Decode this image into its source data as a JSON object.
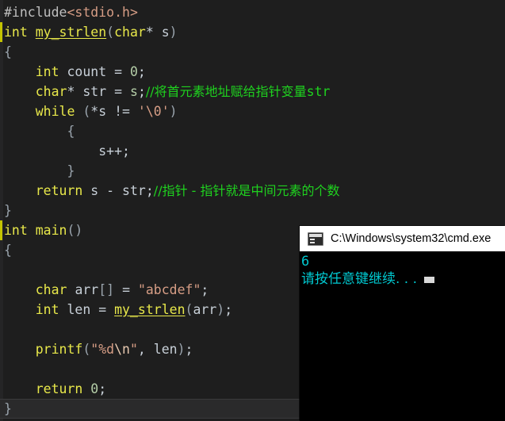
{
  "editor": {
    "theme_background": "#1e1e1e",
    "lines": [
      {
        "indent": 0,
        "tokens": [
          {
            "t": "#include",
            "c": "pp"
          },
          {
            "t": "<stdio.h>",
            "c": "hdr"
          }
        ]
      },
      {
        "indent": 0,
        "changed": true,
        "tokens": [
          {
            "t": "int",
            "c": "kw"
          },
          {
            "t": " ",
            "c": "punc"
          },
          {
            "t": "my_strlen",
            "c": "fn"
          },
          {
            "t": "(",
            "c": "brc"
          },
          {
            "t": "char",
            "c": "kw"
          },
          {
            "t": "* ",
            "c": "punc"
          },
          {
            "t": "s",
            "c": "id"
          },
          {
            "t": ")",
            "c": "brc"
          }
        ]
      },
      {
        "indent": 0,
        "tokens": [
          {
            "t": "{",
            "c": "brc"
          }
        ]
      },
      {
        "indent": 1,
        "tokens": [
          {
            "t": "int",
            "c": "kw"
          },
          {
            "t": " ",
            "c": "punc"
          },
          {
            "t": "count",
            "c": "id"
          },
          {
            "t": " = ",
            "c": "punc"
          },
          {
            "t": "0",
            "c": "num"
          },
          {
            "t": ";",
            "c": "punc"
          }
        ]
      },
      {
        "indent": 1,
        "tokens": [
          {
            "t": "char",
            "c": "kw"
          },
          {
            "t": "* ",
            "c": "punc"
          },
          {
            "t": "str",
            "c": "id"
          },
          {
            "t": " = ",
            "c": "punc"
          },
          {
            "t": "s",
            "c": "num"
          },
          {
            "t": ";",
            "c": "punc"
          },
          {
            "t": "//将首元素地址赋给指针变量",
            "c": "cmt cjk"
          },
          {
            "t": "str",
            "c": "cmt"
          }
        ]
      },
      {
        "indent": 1,
        "tokens": [
          {
            "t": "while",
            "c": "kw"
          },
          {
            "t": " ",
            "c": "punc"
          },
          {
            "t": "(",
            "c": "brc"
          },
          {
            "t": "*s != ",
            "c": "punc"
          },
          {
            "t": "'\\0'",
            "c": "str"
          },
          {
            "t": ")",
            "c": "brc"
          }
        ]
      },
      {
        "indent": 2,
        "tokens": [
          {
            "t": "{",
            "c": "brc"
          }
        ]
      },
      {
        "indent": 3,
        "tokens": [
          {
            "t": "s++;",
            "c": "id"
          }
        ]
      },
      {
        "indent": 2,
        "tokens": [
          {
            "t": "}",
            "c": "brc"
          }
        ]
      },
      {
        "indent": 1,
        "tokens": [
          {
            "t": "return",
            "c": "kw"
          },
          {
            "t": " ",
            "c": "punc"
          },
          {
            "t": "s",
            "c": "id"
          },
          {
            "t": " - ",
            "c": "punc"
          },
          {
            "t": "str",
            "c": "id"
          },
          {
            "t": ";",
            "c": "punc"
          },
          {
            "t": "//指针 - 指针就是中间元素的个数",
            "c": "cmt cjk"
          }
        ]
      },
      {
        "indent": 0,
        "tokens": [
          {
            "t": "}",
            "c": "brc"
          }
        ]
      },
      {
        "indent": 0,
        "changed": true,
        "tokens": [
          {
            "t": "int",
            "c": "kw"
          },
          {
            "t": " ",
            "c": "punc"
          },
          {
            "t": "main",
            "c": "kw"
          },
          {
            "t": "()",
            "c": "brc"
          }
        ]
      },
      {
        "indent": 0,
        "tokens": [
          {
            "t": "{",
            "c": "brc"
          }
        ]
      },
      {
        "indent": 0,
        "tokens": []
      },
      {
        "indent": 1,
        "tokens": [
          {
            "t": "char",
            "c": "kw"
          },
          {
            "t": " ",
            "c": "punc"
          },
          {
            "t": "arr",
            "c": "id"
          },
          {
            "t": "[] ",
            "c": "brc"
          },
          {
            "t": "= ",
            "c": "punc"
          },
          {
            "t": "\"abcdef\"",
            "c": "str"
          },
          {
            "t": ";",
            "c": "punc"
          }
        ]
      },
      {
        "indent": 1,
        "tokens": [
          {
            "t": "int",
            "c": "kw"
          },
          {
            "t": " ",
            "c": "punc"
          },
          {
            "t": "len",
            "c": "id"
          },
          {
            "t": " = ",
            "c": "punc"
          },
          {
            "t": "my_strlen",
            "c": "fn"
          },
          {
            "t": "(",
            "c": "brc"
          },
          {
            "t": "arr",
            "c": "id"
          },
          {
            "t": ")",
            "c": "brc"
          },
          {
            "t": ";",
            "c": "punc"
          }
        ]
      },
      {
        "indent": 0,
        "tokens": []
      },
      {
        "indent": 1,
        "tokens": [
          {
            "t": "printf",
            "c": "kw"
          },
          {
            "t": "(",
            "c": "brc"
          },
          {
            "t": "\"%d",
            "c": "str"
          },
          {
            "t": "\\n",
            "c": "esc"
          },
          {
            "t": "\"",
            "c": "str"
          },
          {
            "t": ", ",
            "c": "punc"
          },
          {
            "t": "len",
            "c": "id"
          },
          {
            "t": ")",
            "c": "brc"
          },
          {
            "t": ";",
            "c": "punc"
          }
        ]
      },
      {
        "indent": 0,
        "tokens": []
      },
      {
        "indent": 1,
        "tokens": [
          {
            "t": "return",
            "c": "kw"
          },
          {
            "t": " ",
            "c": "punc"
          },
          {
            "t": "0",
            "c": "num"
          },
          {
            "t": ";",
            "c": "punc"
          }
        ]
      },
      {
        "indent": 0,
        "current": true,
        "tokens": [
          {
            "t": "}",
            "c": "brc"
          }
        ]
      }
    ]
  },
  "console": {
    "icon": "cmd-icon",
    "title": "C:\\Windows\\system32\\cmd.exe",
    "text_color": "#00c8d0",
    "background": "#000000",
    "output_lines": [
      {
        "text": "6",
        "cjk": false,
        "cursor": false
      },
      {
        "text": "请按任意键继续. . .",
        "cjk": true,
        "cursor": true
      }
    ]
  }
}
